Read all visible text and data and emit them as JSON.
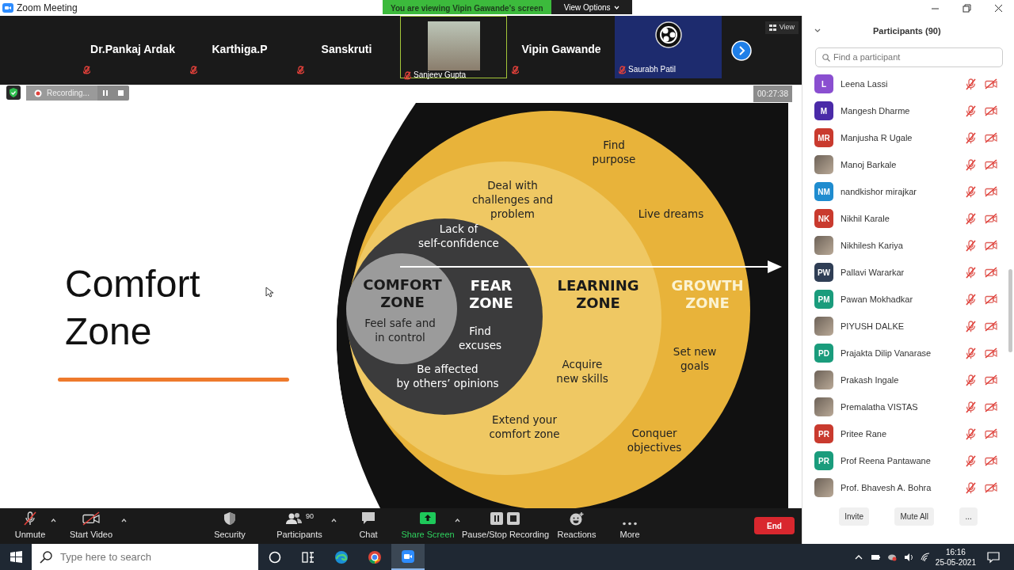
{
  "window": {
    "title": "Zoom Meeting"
  },
  "share_banner": {
    "text": "You are viewing Vipin Gawande's screen",
    "options": "View Options"
  },
  "video_tiles": [
    {
      "name": "Dr.Pankaj Ardak",
      "kind": "name",
      "muted": true,
      "highlighted": false
    },
    {
      "name": "Karthiga.P",
      "kind": "name",
      "muted": true,
      "highlighted": false
    },
    {
      "name": "Sanskruti",
      "kind": "name",
      "muted": true,
      "highlighted": false
    },
    {
      "name": "Sanjeev Gupta",
      "kind": "photo",
      "muted": true,
      "highlighted": true
    },
    {
      "name": "Vipin Gawande",
      "kind": "name",
      "muted": true,
      "highlighted": false
    },
    {
      "name": "Saurabh Patil",
      "kind": "logo",
      "muted": true,
      "highlighted": false
    }
  ],
  "view_button": "View",
  "recording": {
    "label": "Recording..."
  },
  "timer": "00:27:38",
  "slide": {
    "title": "Comfort Zone"
  },
  "diagram": {
    "zones": [
      {
        "lines": [
          "COMFORT",
          "ZONE"
        ]
      },
      {
        "lines": [
          "FEAR",
          "ZONE"
        ]
      },
      {
        "lines": [
          "LEARNING",
          "ZONE"
        ]
      },
      {
        "lines": [
          "GROWTH",
          "ZONE"
        ]
      }
    ],
    "notes": [
      {
        "lines": [
          "Find",
          "purpose"
        ]
      },
      {
        "lines": [
          "Deal with",
          "challenges and",
          "problem"
        ]
      },
      {
        "lines": [
          "Live dreams"
        ]
      },
      {
        "lines": [
          "Lack of",
          "self-confidence"
        ]
      },
      {
        "lines": [
          "Feel safe and",
          "in control"
        ]
      },
      {
        "lines": [
          "Find",
          "excuses"
        ]
      },
      {
        "lines": [
          "Set new",
          "goals"
        ]
      },
      {
        "lines": [
          "Be affected",
          "by others’ opinions"
        ]
      },
      {
        "lines": [
          "Acquire",
          "new skills"
        ]
      },
      {
        "lines": [
          "Extend your",
          "comfort zone"
        ]
      },
      {
        "lines": [
          "Conquer",
          "objectives"
        ]
      }
    ]
  },
  "participants": {
    "title": "Participants (90)",
    "search": {
      "placeholder": "Find a participant"
    },
    "people": [
      {
        "name": "Leena Lassi",
        "kind": "initials",
        "initials": "L",
        "color": "#8a4fd0",
        "muted": true,
        "video_off": true
      },
      {
        "name": "Mangesh Dharme",
        "kind": "initials",
        "initials": "M",
        "color": "#4a2aa8",
        "muted": true,
        "video_off": true
      },
      {
        "name": "Manjusha R Ugale",
        "kind": "initials",
        "initials": "MR",
        "color": "#c93a2e",
        "muted": true,
        "video_off": true
      },
      {
        "name": "Manoj Barkale",
        "kind": "photo",
        "muted": true,
        "video_off": true
      },
      {
        "name": "nandkishor mirajkar",
        "kind": "initials",
        "initials": "NM",
        "color": "#1f8ccf",
        "muted": true,
        "video_off": true
      },
      {
        "name": "Nikhil Karale",
        "kind": "initials",
        "initials": "NK",
        "color": "#c93a2e",
        "muted": true,
        "video_off": true
      },
      {
        "name": "Nikhilesh Kariya",
        "kind": "photo",
        "muted": true,
        "video_off": true
      },
      {
        "name": "Pallavi Wararkar",
        "kind": "initials",
        "initials": "PW",
        "color": "#2f3e55",
        "muted": true,
        "video_off": true
      },
      {
        "name": "Pawan Mokhadkar",
        "kind": "initials",
        "initials": "PM",
        "color": "#1a9c7c",
        "muted": true,
        "video_off": true
      },
      {
        "name": "PIYUSH DALKE",
        "kind": "photo",
        "muted": true,
        "video_off": true
      },
      {
        "name": "Prajakta Dilip Vanarase",
        "kind": "initials",
        "initials": "PD",
        "color": "#1a9c7c",
        "muted": true,
        "video_off": true
      },
      {
        "name": "Prakash Ingale",
        "kind": "photo",
        "muted": true,
        "video_off": true
      },
      {
        "name": "Premalatha VISTAS",
        "kind": "photo",
        "muted": true,
        "video_off": true
      },
      {
        "name": "Pritee Rane",
        "kind": "initials",
        "initials": "PR",
        "color": "#c93a2e",
        "muted": true,
        "video_off": true
      },
      {
        "name": "Prof Reena Pantawane",
        "kind": "initials",
        "initials": "PR",
        "color": "#1a9c7c",
        "muted": true,
        "video_off": true
      },
      {
        "name": "Prof. Bhavesh A. Bohra",
        "kind": "photo",
        "muted": true,
        "video_off": true
      }
    ],
    "buttons": [
      "Invite",
      "Mute All",
      "..."
    ]
  },
  "toolbar": {
    "items": [
      {
        "label": "Unmute",
        "kind": "mic",
        "off": true,
        "caret": true
      },
      {
        "label": "Start Video",
        "kind": "video",
        "off": true,
        "caret": true
      },
      {
        "label": "Security",
        "kind": "shield"
      },
      {
        "label": "Participants",
        "kind": "people",
        "count": "90",
        "caret": true
      },
      {
        "label": "Chat",
        "kind": "chat"
      },
      {
        "label": "Share Screen",
        "kind": "share",
        "caret": true
      },
      {
        "label": "Pause/Stop Recording",
        "kind": "record"
      },
      {
        "label": "Reactions",
        "kind": "emoji"
      },
      {
        "label": "More",
        "kind": "dots"
      }
    ],
    "end": "End"
  },
  "taskbar": {
    "search": {
      "placeholder": "Type here to search"
    },
    "apps": [
      {
        "kind": "circle",
        "selected": false
      },
      {
        "kind": "taskview",
        "selected": false
      },
      {
        "kind": "swirl",
        "selected": false
      },
      {
        "kind": "ring",
        "selected": false
      },
      {
        "kind": "camera",
        "selected": true
      }
    ],
    "time": "16:16",
    "date": "25-05-2021"
  }
}
